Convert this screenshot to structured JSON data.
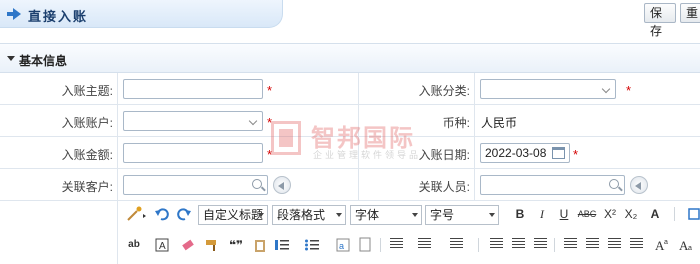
{
  "header": {
    "title": "直接入账",
    "save_label": "保存",
    "reset_label": "重"
  },
  "section": {
    "title": "基本信息"
  },
  "form": {
    "subject_label": "入账主题:",
    "category_label": "入账分类:",
    "account_label": "入账账户:",
    "currency_label": "币种:",
    "currency_value": "人民币",
    "amount_label": "入账金额:",
    "date_label": "入账日期:",
    "date_value": "2022-03-08",
    "customer_label": "关联客户:",
    "person_label": "关联人员:",
    "required_mark": "*"
  },
  "watermark": {
    "name": "智邦国际",
    "tagline": "企业管理软件领导品"
  },
  "editor": {
    "heading_select": "自定义标题",
    "paragraph_select": "段落格式",
    "font_select": "字体",
    "size_select": "字号",
    "bold": "B",
    "italic": "I",
    "underline": "U",
    "strike": "ABC",
    "superscript": "X²",
    "subscript": "X₂",
    "font_color": "A",
    "bg_text": "ab",
    "quote": "❝❞"
  },
  "colors": {
    "accent": "#1b3f6e",
    "required": "#d40000",
    "border": "#dfe6ee"
  }
}
